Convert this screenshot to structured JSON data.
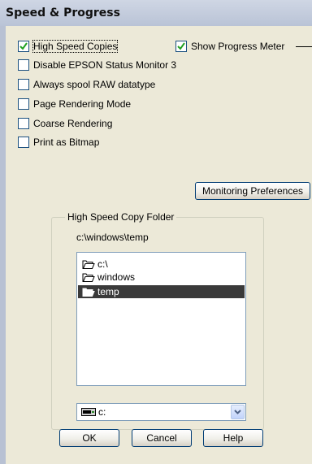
{
  "window": {
    "title": "Speed & Progress"
  },
  "options": {
    "high_speed_copies": {
      "label": "High Speed Copies",
      "checked": true
    },
    "show_progress_meter": {
      "label": "Show Progress Meter",
      "checked": true
    },
    "disable_status_monitor": {
      "label": "Disable EPSON Status Monitor 3",
      "checked": false
    },
    "always_spool_raw": {
      "label": "Always spool RAW datatype",
      "checked": false
    },
    "page_rendering_mode": {
      "label": "Page Rendering Mode",
      "checked": false
    },
    "coarse_rendering": {
      "label": "Coarse Rendering",
      "checked": false
    },
    "print_as_bitmap": {
      "label": "Print as Bitmap",
      "checked": false
    }
  },
  "monitoring_button": {
    "label": "Monitoring Preferences"
  },
  "folder_group": {
    "legend": "High Speed Copy Folder",
    "current_path": "c:\\windows\\temp",
    "tree": [
      {
        "label": "c:\\",
        "selected": false
      },
      {
        "label": "windows",
        "selected": false
      },
      {
        "label": "temp",
        "selected": true
      }
    ],
    "drive_select": {
      "value": "c:"
    }
  },
  "buttons": {
    "ok": "OK",
    "cancel": "Cancel",
    "help": "Help"
  },
  "colors": {
    "selection": "#3a3a3a",
    "titlebar": "#c4cddf",
    "dialog": "#ece9d8",
    "check": "#21a121"
  }
}
